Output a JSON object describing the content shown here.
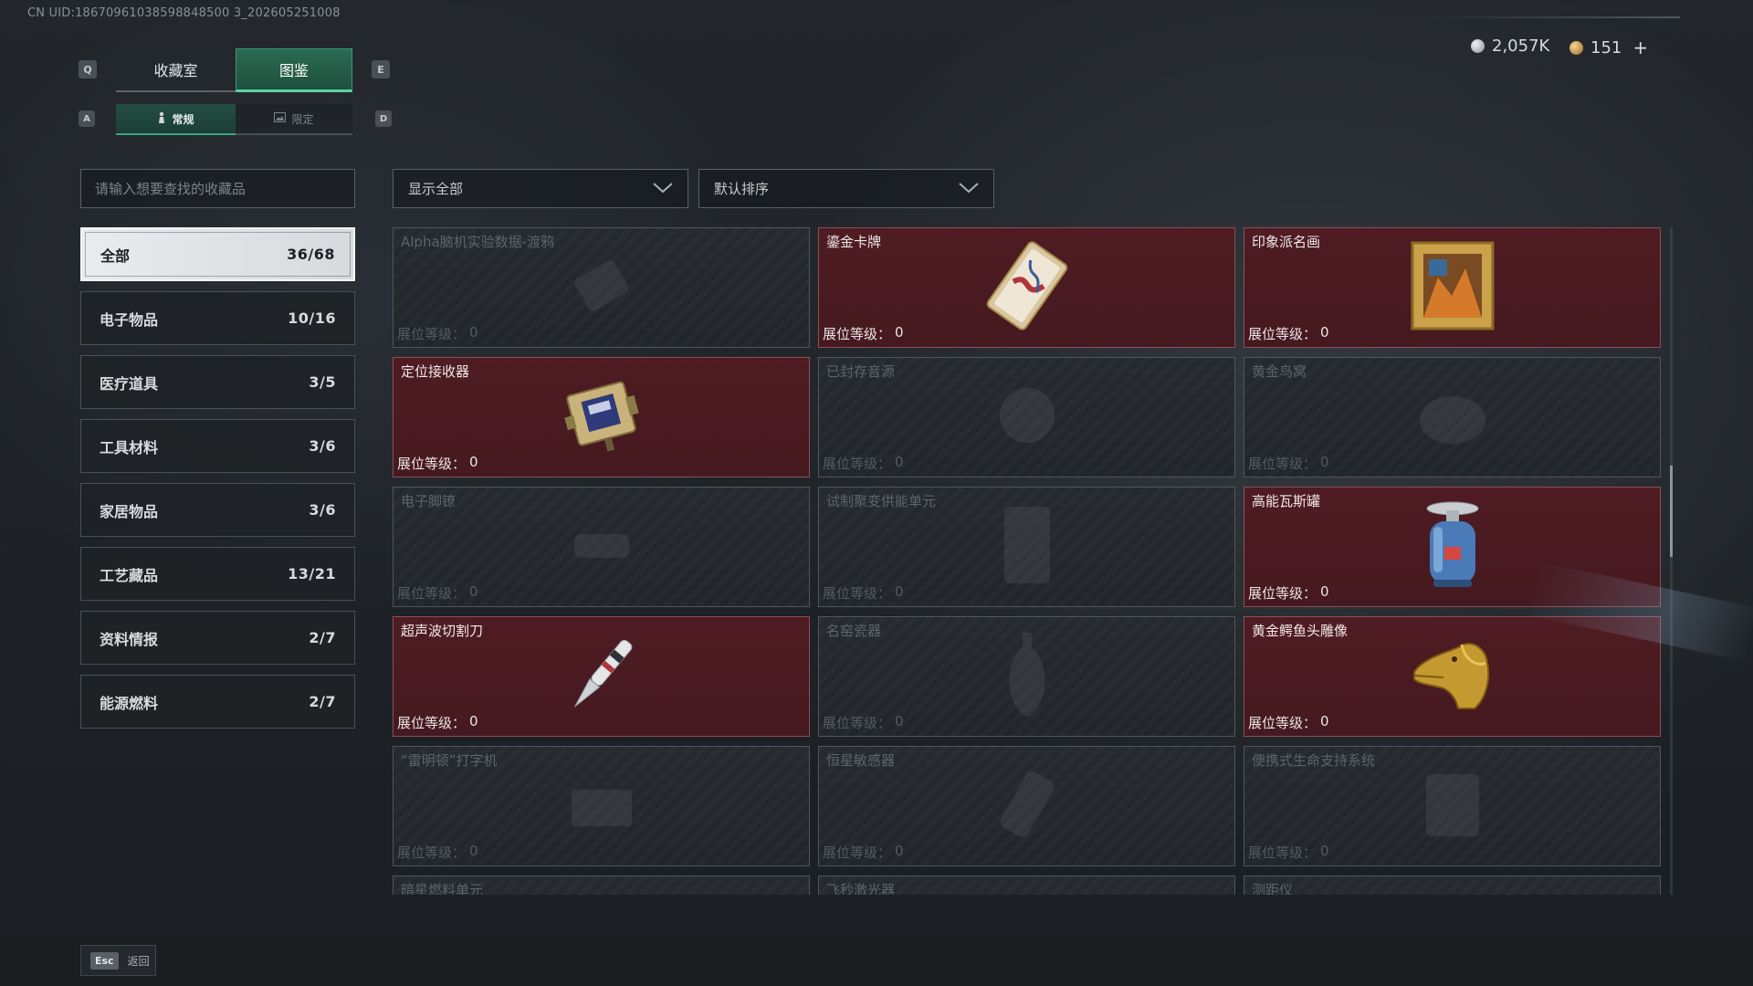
{
  "header": {
    "uid": "CN UID:18670961038598848500 3_202605251008",
    "tabs": [
      {
        "label": "收藏室",
        "key": "Q"
      },
      {
        "label": "图鉴",
        "key": "E"
      }
    ],
    "subtabs": [
      {
        "label": "常规",
        "key": "A",
        "icon": "figure-icon"
      },
      {
        "label": "限定",
        "key": "D",
        "icon": "image-icon"
      }
    ],
    "currency": [
      {
        "value": "2,057K",
        "icon": "silver-coin-icon",
        "color": "#c7ccd1"
      },
      {
        "value": "151",
        "icon": "gold-coin-icon",
        "color": "#d6a955",
        "add": "+"
      }
    ]
  },
  "search": {
    "placeholder": "请输入想要查找的收藏品"
  },
  "filters": {
    "show": "显示全部",
    "sort": "默认排序"
  },
  "categories": [
    {
      "label": "全部",
      "count": "36/68",
      "active": true
    },
    {
      "label": "电子物品",
      "count": "10/16"
    },
    {
      "label": "医疗道具",
      "count": "3/5"
    },
    {
      "label": "工具材料",
      "count": "3/6"
    },
    {
      "label": "家居物品",
      "count": "3/6"
    },
    {
      "label": "工艺藏品",
      "count": "13/21"
    },
    {
      "label": "资料情报",
      "count": "2/7"
    },
    {
      "label": "能源燃料",
      "count": "2/7"
    }
  ],
  "level_label": "展位等级：",
  "items": [
    {
      "name": "Alpha脑机实验数据-渡鸦",
      "level": "0",
      "owned": false,
      "icon": "data-drive-icon"
    },
    {
      "name": "鎏金卡牌",
      "level": "0",
      "owned": true,
      "icon": "gilded-card-icon"
    },
    {
      "name": "印象派名画",
      "level": "0",
      "owned": true,
      "icon": "painting-icon"
    },
    {
      "name": "定位接收器",
      "level": "0",
      "owned": true,
      "icon": "receiver-icon"
    },
    {
      "name": "已封存音源",
      "level": "0",
      "owned": false,
      "icon": "sealed-audio-icon"
    },
    {
      "name": "黄金鸟窝",
      "level": "0",
      "owned": false,
      "icon": "golden-nest-icon"
    },
    {
      "name": "电子脚镣",
      "level": "0",
      "owned": false,
      "icon": "ankle-monitor-icon"
    },
    {
      "name": "试制聚变供能单元",
      "level": "0",
      "owned": false,
      "icon": "fusion-unit-icon"
    },
    {
      "name": "高能瓦斯罐",
      "level": "0",
      "owned": true,
      "icon": "gas-tank-icon"
    },
    {
      "name": "超声波切割刀",
      "level": "0",
      "owned": true,
      "icon": "ultrasonic-knife-icon"
    },
    {
      "name": "名窑瓷器",
      "level": "0",
      "owned": false,
      "icon": "porcelain-vase-icon"
    },
    {
      "name": "黄金鳄鱼头雕像",
      "level": "0",
      "owned": true,
      "icon": "golden-crocodile-icon"
    },
    {
      "name": "“雷明顿”打字机",
      "level": "0",
      "owned": false,
      "icon": "typewriter-icon"
    },
    {
      "name": "恒星敏感器",
      "level": "0",
      "owned": false,
      "icon": "star-sensor-icon"
    },
    {
      "name": "便携式生命支持系统",
      "level": "0",
      "owned": false,
      "icon": "life-support-icon"
    },
    {
      "name": "暗星燃料单元",
      "level": "",
      "owned": false,
      "icon": "fuel-cell-icon"
    },
    {
      "name": "飞秒激光器",
      "level": "",
      "owned": false,
      "icon": "laser-icon"
    },
    {
      "name": "测距仪",
      "level": "",
      "owned": false,
      "icon": "rangefinder-icon"
    }
  ],
  "footer": {
    "esc_key": "Esc",
    "back_label": "返回"
  }
}
